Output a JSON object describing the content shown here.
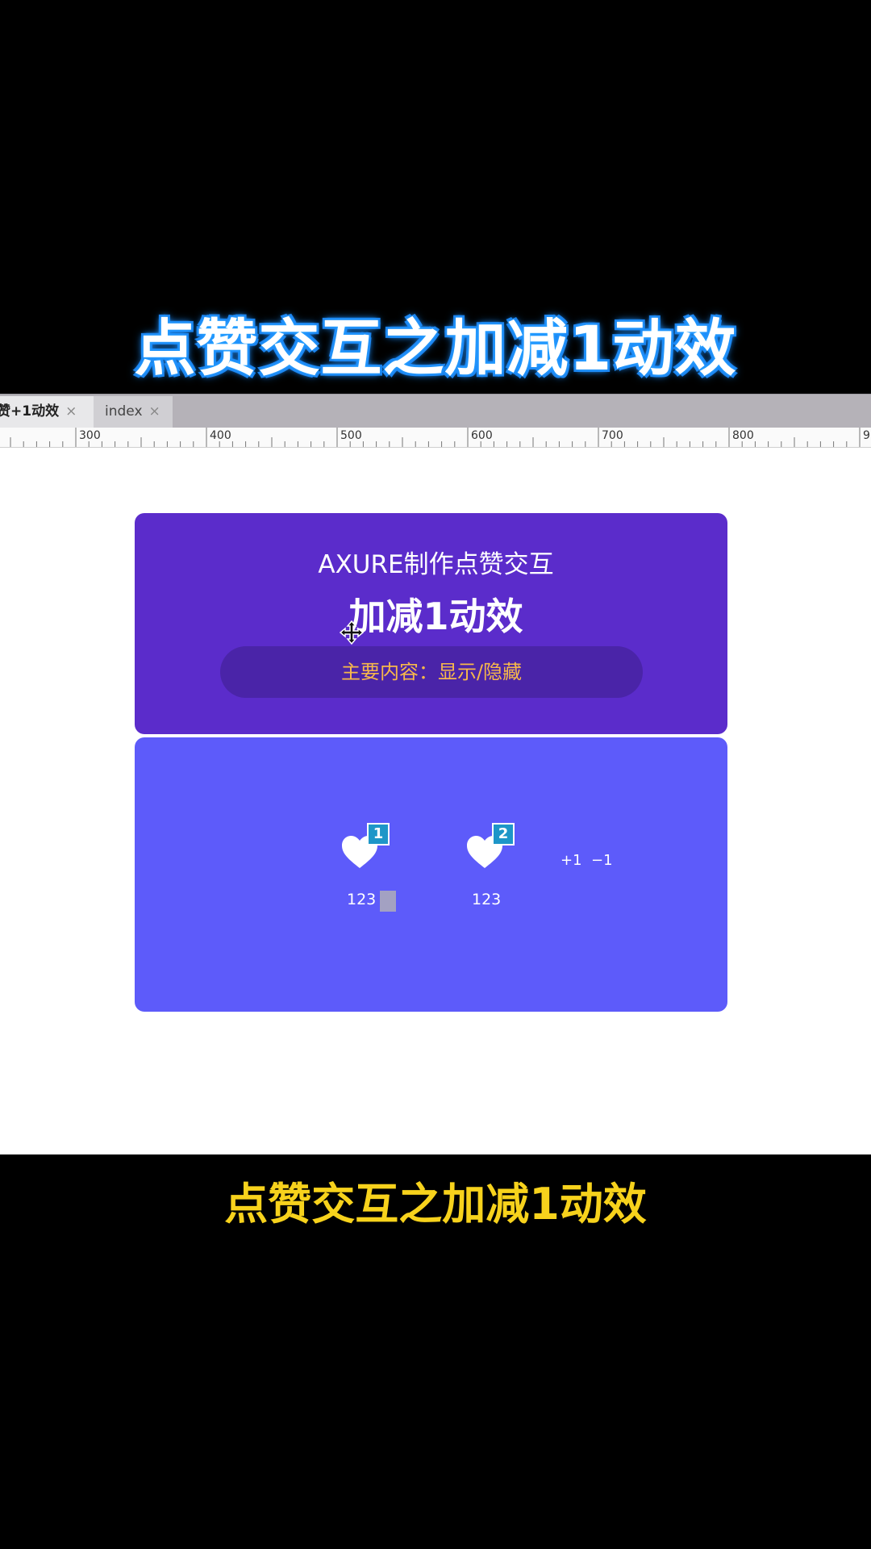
{
  "overlay": {
    "top_title": "点赞交互之加减1动效",
    "bottom_caption": "点赞交互之加减1动效"
  },
  "editor": {
    "tabs": [
      {
        "label": "赞+1动效",
        "close": "×"
      },
      {
        "label": "index",
        "close": "×"
      }
    ],
    "ruler": {
      "labels": [
        "300",
        "400",
        "500",
        "600",
        "700",
        "800",
        "9"
      ]
    }
  },
  "prototype": {
    "header_card": {
      "subtitle": "AXURE制作点赞交互",
      "title": "加减1动效",
      "pill_text": "主要内容：显示/隐藏",
      "pill_color": "#f7b84b",
      "background": "#5b2ccb"
    },
    "demo_card": {
      "background": "#5d5bfa",
      "likes": [
        {
          "badge": "1",
          "count": "123"
        },
        {
          "badge": "2",
          "count": "123"
        }
      ],
      "plus_label": "+1",
      "minus_label": "−1"
    }
  },
  "icons": [
    "heart-icon",
    "move-cursor-icon",
    "close-icon"
  ]
}
